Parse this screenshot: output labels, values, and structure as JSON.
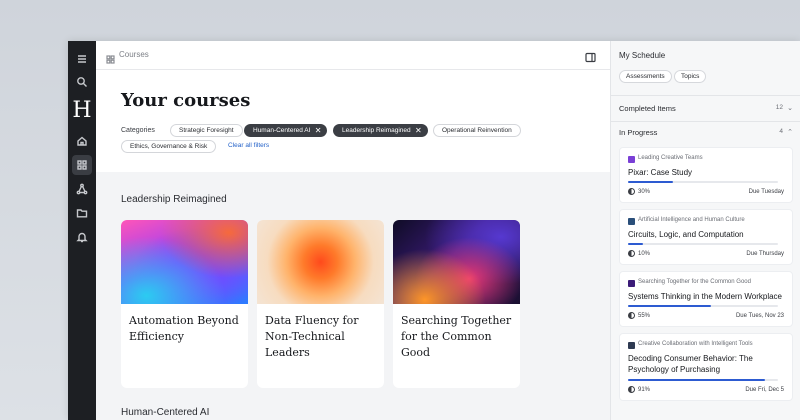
{
  "breadcrumb": {
    "label": "Courses"
  },
  "rail": {
    "logo": "H"
  },
  "page": {
    "title": "Your courses"
  },
  "filters": {
    "label": "Categories",
    "chips": [
      {
        "label": "Strategic Foresight",
        "selected": false
      },
      {
        "label": "Human-Centered AI",
        "selected": true
      },
      {
        "label": "Leadership Reimagined",
        "selected": true
      },
      {
        "label": "Operational Reinvention",
        "selected": false
      },
      {
        "label": "Ethics, Governance & Risk",
        "selected": false
      }
    ],
    "clear_label": "Clear all filters",
    "remove_glyph": "✕"
  },
  "sections": [
    {
      "title": "Leadership Reimagined",
      "cards": [
        {
          "title": "Automation Beyond Efficiency"
        },
        {
          "title": "Data Fluency for Non-Technical Leaders"
        },
        {
          "title": "Searching Together for the Common Good"
        }
      ]
    },
    {
      "title": "Human-Centered AI"
    }
  ],
  "schedule": {
    "title": "My Schedule",
    "tabs": [
      "Assessments",
      "Topics"
    ],
    "completed": {
      "label": "Completed Items",
      "count": "12"
    },
    "in_progress": {
      "label": "In Progress",
      "count": "4"
    },
    "items": [
      {
        "course": "Leading Creative Teams",
        "name": "Pixar: Case Study",
        "progress_label": "30%",
        "progress": 0.3,
        "due": "Due Tuesday",
        "thumb_color": "#7a3fd6"
      },
      {
        "course": "Artificial Intelligence and Human Culture",
        "name": "Circuits, Logic, and Computation",
        "progress_label": "10%",
        "progress": 0.1,
        "due": "Due Thursday",
        "thumb_color": "#2a4f7a"
      },
      {
        "course": "Searching Together for the Common Good",
        "name": "Systems Thinking in the Modern Workplace",
        "progress_label": "55%",
        "progress": 0.55,
        "due": "Due Tues, Nov 23",
        "thumb_color": "#3b1b78"
      },
      {
        "course": "Creative Collaboration with Intelligent Tools",
        "name": "Decoding Consumer Behavior: The Psychology of Purchasing",
        "progress_label": "91%",
        "progress": 0.91,
        "due": "Due Fri, Dec 5",
        "thumb_color": "#2e3a52"
      }
    ],
    "accent_color": "#2d5bd1"
  }
}
